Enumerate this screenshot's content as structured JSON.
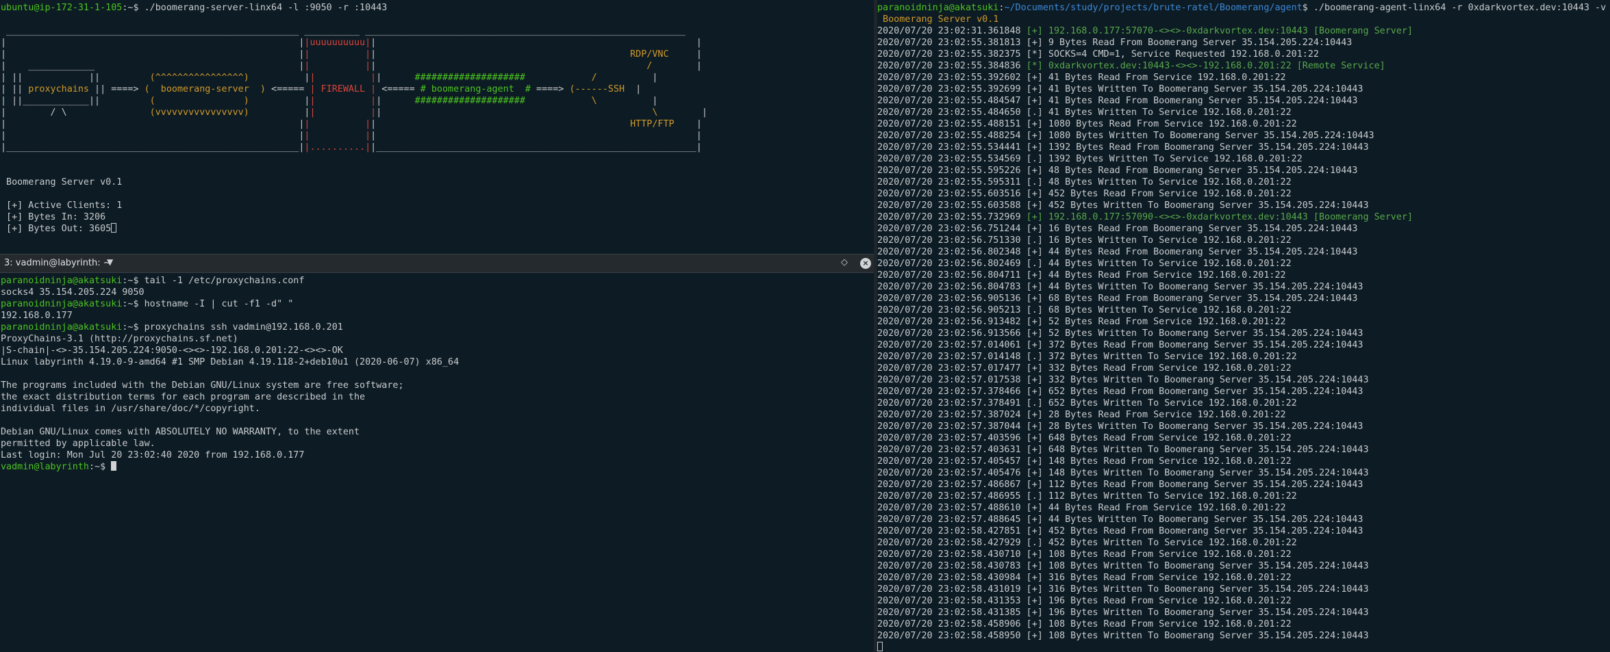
{
  "colors": {
    "background": "#0d1b24",
    "text": "#c8ccce",
    "green": "#4bc41f",
    "red": "#d8443c",
    "orange": "#cf9a2a",
    "blue": "#3c89d6"
  },
  "top_left": {
    "lines": [
      [
        {
          "t": "ubuntu@ip-172-31-1-105",
          "c": "green"
        },
        {
          "t": ":~$ ./boomerang-server-linx64 -l :9050 -r :10443",
          "c": "white"
        }
      ],
      [
        {
          "t": " ",
          "c": "white"
        }
      ],
      [
        {
          "t": " _____________________________________________________ __________ __________________________________________________________",
          "c": "white"
        }
      ],
      [
        {
          "t": "|                                                     |",
          "c": "white"
        },
        {
          "t": "|uuuuuuuuuu|",
          "c": "red"
        },
        {
          "t": "|                                                          |",
          "c": "white"
        }
      ],
      [
        {
          "t": "|                                                     |",
          "c": "white"
        },
        {
          "t": "|          |",
          "c": "red"
        },
        {
          "t": "|                                              ",
          "c": "white"
        },
        {
          "t": "RDP/VNC",
          "c": "orange"
        },
        {
          "t": "     |",
          "c": "white"
        }
      ],
      [
        {
          "t": "|    ____________                                     |",
          "c": "white"
        },
        {
          "t": "|          |",
          "c": "red"
        },
        {
          "t": "|                                              ",
          "c": "white"
        },
        {
          "t": "   /   ",
          "c": "orange"
        },
        {
          "t": "     |",
          "c": "white"
        }
      ],
      [
        {
          "t": "| ||            ||         ",
          "c": "white"
        },
        {
          "t": "(^^^^^^^^^^^^^^^^)",
          "c": "orange"
        },
        {
          "t": "          |",
          "c": "white"
        },
        {
          "t": "|          |",
          "c": "red"
        },
        {
          "t": "|      ",
          "c": "white"
        },
        {
          "t": "####################",
          "c": "green"
        },
        {
          "t": "          ",
          "c": "white"
        },
        {
          "t": "  /    ",
          "c": "orange"
        },
        {
          "t": "      |",
          "c": "white"
        }
      ],
      [
        {
          "t": "| ||",
          "c": "white"
        },
        {
          "t": " proxychains",
          "c": "orange"
        },
        {
          "t": " || ====> ",
          "c": "white"
        },
        {
          "t": "(  boomerang-server  )",
          "c": "orange"
        },
        {
          "t": " <===== ",
          "c": "white"
        },
        {
          "t": "| FIREWALL |",
          "c": "red"
        },
        {
          "t": " <===== ",
          "c": "white"
        },
        {
          "t": "# boomerang-agent  #",
          "c": "green"
        },
        {
          "t": " ====> ",
          "c": "white"
        },
        {
          "t": "(------SSH",
          "c": "orange"
        },
        {
          "t": "  |",
          "c": "white"
        }
      ],
      [
        {
          "t": "| ||____________||         ",
          "c": "white"
        },
        {
          "t": "(                )",
          "c": "orange"
        },
        {
          "t": "          |",
          "c": "white"
        },
        {
          "t": "|          |",
          "c": "red"
        },
        {
          "t": "|      ",
          "c": "white"
        },
        {
          "t": "####################",
          "c": "green"
        },
        {
          "t": "          ",
          "c": "white"
        },
        {
          "t": "  \\    ",
          "c": "orange"
        },
        {
          "t": "      |",
          "c": "white"
        }
      ],
      [
        {
          "t": "|        / \\               ",
          "c": "white"
        },
        {
          "t": "(vvvvvvvvvvvvvvvv)",
          "c": "orange"
        },
        {
          "t": "          |",
          "c": "white"
        },
        {
          "t": "|          |",
          "c": "red"
        },
        {
          "t": "|                                              ",
          "c": "white"
        },
        {
          "t": "   \\   ",
          "c": "orange"
        },
        {
          "t": "     |",
          "c": "white"
        }
      ],
      [
        {
          "t": "|                                                     |",
          "c": "white"
        },
        {
          "t": "|          |",
          "c": "red"
        },
        {
          "t": "|                                              ",
          "c": "white"
        },
        {
          "t": "HTTP/FTP",
          "c": "orange"
        },
        {
          "t": "    |",
          "c": "white"
        }
      ],
      [
        {
          "t": "|                                                     |",
          "c": "white"
        },
        {
          "t": "|          |",
          "c": "red"
        },
        {
          "t": "|                                                          |",
          "c": "white"
        }
      ],
      [
        {
          "t": "|_____________________________________________________|",
          "c": "white"
        },
        {
          "t": "|..........|",
          "c": "red"
        },
        {
          "t": "|__________________________________________________________|",
          "c": "white"
        }
      ],
      [
        {
          "t": " ",
          "c": "white"
        }
      ],
      [
        {
          "t": " ",
          "c": "white"
        }
      ],
      [
        {
          "t": " Boomerang Server v0.1",
          "c": "white"
        }
      ],
      [
        {
          "t": " ",
          "c": "white"
        }
      ],
      [
        {
          "t": " [+] Active Clients: 1",
          "c": "white"
        }
      ],
      [
        {
          "t": " [+] Bytes In: 3206",
          "c": "white"
        }
      ],
      [
        {
          "t": " [+] Bytes Out: 3605",
          "c": "white"
        },
        {
          "cursor": "hollow"
        }
      ]
    ]
  },
  "tab": {
    "title": "3: vadmin@labyrinth: ~",
    "float_label": "◇",
    "close_label": "×"
  },
  "bottom_left": {
    "lines": [
      [
        {
          "t": "paranoidninja@akatsuki",
          "c": "green"
        },
        {
          "t": ":~$ tail -1 /etc/proxychains.conf",
          "c": "white"
        }
      ],
      [
        {
          "t": "socks4 35.154.205.224 9050",
          "c": "white"
        }
      ],
      [
        {
          "t": "paranoidninja@akatsuki",
          "c": "green"
        },
        {
          "t": ":~$ hostname -I | cut -f1 -d\" \"",
          "c": "white"
        }
      ],
      [
        {
          "t": "192.168.0.177",
          "c": "white"
        }
      ],
      [
        {
          "t": "paranoidninja@akatsuki",
          "c": "green"
        },
        {
          "t": ":~$ proxychains ssh vadmin@192.168.0.201",
          "c": "white"
        }
      ],
      [
        {
          "t": "ProxyChains-3.1 (http://proxychains.sf.net)",
          "c": "white"
        }
      ],
      [
        {
          "t": "|S-chain|-<>-35.154.205.224:9050-<><>-192.168.0.201:22-<><>-OK",
          "c": "white"
        }
      ],
      [
        {
          "t": "Linux labyrinth 4.19.0-9-amd64 #1 SMP Debian 4.19.118-2+deb10u1 (2020-06-07) x86_64",
          "c": "white"
        }
      ],
      [
        {
          "t": " ",
          "c": "white"
        }
      ],
      [
        {
          "t": "The programs included with the Debian GNU/Linux system are free software;",
          "c": "white"
        }
      ],
      [
        {
          "t": "the exact distribution terms for each program are described in the",
          "c": "white"
        }
      ],
      [
        {
          "t": "individual files in /usr/share/doc/*/copyright.",
          "c": "white"
        }
      ],
      [
        {
          "t": " ",
          "c": "white"
        }
      ],
      [
        {
          "t": "Debian GNU/Linux comes with ABSOLUTELY NO WARRANTY, to the extent",
          "c": "white"
        }
      ],
      [
        {
          "t": "permitted by applicable law.",
          "c": "white"
        }
      ],
      [
        {
          "t": "Last login: Mon Jul 20 23:02:40 2020 from 192.168.0.177",
          "c": "white"
        }
      ],
      [
        {
          "t": "vadmin@labyrinth",
          "c": "green"
        },
        {
          "t": ":~$ ",
          "c": "white"
        },
        {
          "cursor": "solid"
        }
      ]
    ]
  },
  "right": {
    "lines": [
      [
        {
          "t": "paranoidninja@akatsuki",
          "c": "green"
        },
        {
          "t": ":",
          "c": "white"
        },
        {
          "t": "~/Documents/study/projects/brute-ratel/Boomerang/agent",
          "c": "blue"
        },
        {
          "t": "$ ./boomerang-agent-linx64 -r 0xdarkvortex.dev:10443 -v",
          "c": "white"
        }
      ],
      [
        {
          "t": " Boomerang Server v0.1",
          "c": "orange"
        }
      ],
      [
        {
          "t": "2020/07/20 23:02:31.361848 ",
          "c": "white"
        },
        {
          "t": "[+] 192.168.0.177:57070-<><>-0xdarkvortex.dev:10443 [Boomerang Server]",
          "c": "lgreen"
        }
      ],
      [
        {
          "t": "2020/07/20 23:02:55.381813 [+] 9 Bytes Read From Boomerang Server 35.154.205.224:10443",
          "c": "white"
        }
      ],
      [
        {
          "t": "2020/07/20 23:02:55.382375 [*] SOCKS=4 CMD=1, Service Requested 192.168.0.201:22",
          "c": "white"
        }
      ],
      [
        {
          "t": "2020/07/20 23:02:55.384836 ",
          "c": "white"
        },
        {
          "t": "[*] 0xdarkvortex.dev:10443-<><>-192.168.0.201:22 [Remote Service]",
          "c": "lgreen"
        }
      ],
      [
        {
          "t": "2020/07/20 23:02:55.392602 [+] 41 Bytes Read From Service 192.168.0.201:22",
          "c": "white"
        }
      ],
      [
        {
          "t": "2020/07/20 23:02:55.392699 [+] 41 Bytes Written To Boomerang Server 35.154.205.224:10443",
          "c": "white"
        }
      ],
      [
        {
          "t": "2020/07/20 23:02:55.484547 [+] 41 Bytes Read From Boomerang Server 35.154.205.224:10443",
          "c": "white"
        }
      ],
      [
        {
          "t": "2020/07/20 23:02:55.484650 [.] 41 Bytes Written To Service 192.168.0.201:22",
          "c": "white"
        }
      ],
      [
        {
          "t": "2020/07/20 23:02:55.488151 [+] 1080 Bytes Read From Service 192.168.0.201:22",
          "c": "white"
        }
      ],
      [
        {
          "t": "2020/07/20 23:02:55.488254 [+] 1080 Bytes Written To Boomerang Server 35.154.205.224:10443",
          "c": "white"
        }
      ],
      [
        {
          "t": "2020/07/20 23:02:55.534441 [+] 1392 Bytes Read From Boomerang Server 35.154.205.224:10443",
          "c": "white"
        }
      ],
      [
        {
          "t": "2020/07/20 23:02:55.534569 [.] 1392 Bytes Written To Service 192.168.0.201:22",
          "c": "white"
        }
      ],
      [
        {
          "t": "2020/07/20 23:02:55.595226 [+] 48 Bytes Read From Boomerang Server 35.154.205.224:10443",
          "c": "white"
        }
      ],
      [
        {
          "t": "2020/07/20 23:02:55.595311 [.] 48 Bytes Written To Service 192.168.0.201:22",
          "c": "white"
        }
      ],
      [
        {
          "t": "2020/07/20 23:02:55.603516 [+] 452 Bytes Read From Service 192.168.0.201:22",
          "c": "white"
        }
      ],
      [
        {
          "t": "2020/07/20 23:02:55.603588 [+] 452 Bytes Written To Boomerang Server 35.154.205.224:10443",
          "c": "white"
        }
      ],
      [
        {
          "t": "2020/07/20 23:02:55.732969 ",
          "c": "white"
        },
        {
          "t": "[+] 192.168.0.177:57090-<><>-0xdarkvortex.dev:10443 [Boomerang Server]",
          "c": "lgreen"
        }
      ],
      [
        {
          "t": "2020/07/20 23:02:56.751244 [+] 16 Bytes Read From Boomerang Server 35.154.205.224:10443",
          "c": "white"
        }
      ],
      [
        {
          "t": "2020/07/20 23:02:56.751330 [.] 16 Bytes Written To Service 192.168.0.201:22",
          "c": "white"
        }
      ],
      [
        {
          "t": "2020/07/20 23:02:56.802348 [+] 44 Bytes Read From Boomerang Server 35.154.205.224:10443",
          "c": "white"
        }
      ],
      [
        {
          "t": "2020/07/20 23:02:56.802469 [.] 44 Bytes Written To Service 192.168.0.201:22",
          "c": "white"
        }
      ],
      [
        {
          "t": "2020/07/20 23:02:56.804711 [+] 44 Bytes Read From Service 192.168.0.201:22",
          "c": "white"
        }
      ],
      [
        {
          "t": "2020/07/20 23:02:56.804783 [+] 44 Bytes Written To Boomerang Server 35.154.205.224:10443",
          "c": "white"
        }
      ],
      [
        {
          "t": "2020/07/20 23:02:56.905136 [+] 68 Bytes Read From Boomerang Server 35.154.205.224:10443",
          "c": "white"
        }
      ],
      [
        {
          "t": "2020/07/20 23:02:56.905213 [.] 68 Bytes Written To Service 192.168.0.201:22",
          "c": "white"
        }
      ],
      [
        {
          "t": "2020/07/20 23:02:56.913482 [+] 52 Bytes Read From Service 192.168.0.201:22",
          "c": "white"
        }
      ],
      [
        {
          "t": "2020/07/20 23:02:56.913566 [+] 52 Bytes Written To Boomerang Server 35.154.205.224:10443",
          "c": "white"
        }
      ],
      [
        {
          "t": "2020/07/20 23:02:57.014061 [+] 372 Bytes Read From Boomerang Server 35.154.205.224:10443",
          "c": "white"
        }
      ],
      [
        {
          "t": "2020/07/20 23:02:57.014148 [.] 372 Bytes Written To Service 192.168.0.201:22",
          "c": "white"
        }
      ],
      [
        {
          "t": "2020/07/20 23:02:57.017477 [+] 332 Bytes Read From Service 192.168.0.201:22",
          "c": "white"
        }
      ],
      [
        {
          "t": "2020/07/20 23:02:57.017538 [+] 332 Bytes Written To Boomerang Server 35.154.205.224:10443",
          "c": "white"
        }
      ],
      [
        {
          "t": "2020/07/20 23:02:57.378466 [+] 652 Bytes Read From Boomerang Server 35.154.205.224:10443",
          "c": "white"
        }
      ],
      [
        {
          "t": "2020/07/20 23:02:57.378491 [.] 652 Bytes Written To Service 192.168.0.201:22",
          "c": "white"
        }
      ],
      [
        {
          "t": "2020/07/20 23:02:57.387024 [+] 28 Bytes Read From Service 192.168.0.201:22",
          "c": "white"
        }
      ],
      [
        {
          "t": "2020/07/20 23:02:57.387044 [+] 28 Bytes Written To Boomerang Server 35.154.205.224:10443",
          "c": "white"
        }
      ],
      [
        {
          "t": "2020/07/20 23:02:57.403596 [+] 648 Bytes Read From Service 192.168.0.201:22",
          "c": "white"
        }
      ],
      [
        {
          "t": "2020/07/20 23:02:57.403631 [+] 648 Bytes Written To Boomerang Server 35.154.205.224:10443",
          "c": "white"
        }
      ],
      [
        {
          "t": "2020/07/20 23:02:57.405457 [+] 148 Bytes Read From Service 192.168.0.201:22",
          "c": "white"
        }
      ],
      [
        {
          "t": "2020/07/20 23:02:57.405476 [+] 148 Bytes Written To Boomerang Server 35.154.205.224:10443",
          "c": "white"
        }
      ],
      [
        {
          "t": "2020/07/20 23:02:57.486867 [+] 112 Bytes Read From Boomerang Server 35.154.205.224:10443",
          "c": "white"
        }
      ],
      [
        {
          "t": "2020/07/20 23:02:57.486955 [.] 112 Bytes Written To Service 192.168.0.201:22",
          "c": "white"
        }
      ],
      [
        {
          "t": "2020/07/20 23:02:57.488610 [+] 44 Bytes Read From Service 192.168.0.201:22",
          "c": "white"
        }
      ],
      [
        {
          "t": "2020/07/20 23:02:57.488645 [+] 44 Bytes Written To Boomerang Server 35.154.205.224:10443",
          "c": "white"
        }
      ],
      [
        {
          "t": "2020/07/20 23:02:58.427851 [+] 452 Bytes Read From Boomerang Server 35.154.205.224:10443",
          "c": "white"
        }
      ],
      [
        {
          "t": "2020/07/20 23:02:58.427929 [.] 452 Bytes Written To Service 192.168.0.201:22",
          "c": "white"
        }
      ],
      [
        {
          "t": "2020/07/20 23:02:58.430710 [+] 108 Bytes Read From Service 192.168.0.201:22",
          "c": "white"
        }
      ],
      [
        {
          "t": "2020/07/20 23:02:58.430783 [+] 108 Bytes Written To Boomerang Server 35.154.205.224:10443",
          "c": "white"
        }
      ],
      [
        {
          "t": "2020/07/20 23:02:58.430984 [+] 316 Bytes Read From Service 192.168.0.201:22",
          "c": "white"
        }
      ],
      [
        {
          "t": "2020/07/20 23:02:58.431019 [+] 316 Bytes Written To Boomerang Server 35.154.205.224:10443",
          "c": "white"
        }
      ],
      [
        {
          "t": "2020/07/20 23:02:58.431353 [+] 196 Bytes Read From Service 192.168.0.201:22",
          "c": "white"
        }
      ],
      [
        {
          "t": "2020/07/20 23:02:58.431385 [+] 196 Bytes Written To Boomerang Server 35.154.205.224:10443",
          "c": "white"
        }
      ],
      [
        {
          "t": "2020/07/20 23:02:58.458906 [+] 108 Bytes Read From Service 192.168.0.201:22",
          "c": "white"
        }
      ],
      [
        {
          "t": "2020/07/20 23:02:58.458950 [+] 108 Bytes Written To Boomerang Server 35.154.205.224:10443",
          "c": "white"
        }
      ],
      [
        {
          "cursor": "hollow"
        }
      ]
    ]
  }
}
